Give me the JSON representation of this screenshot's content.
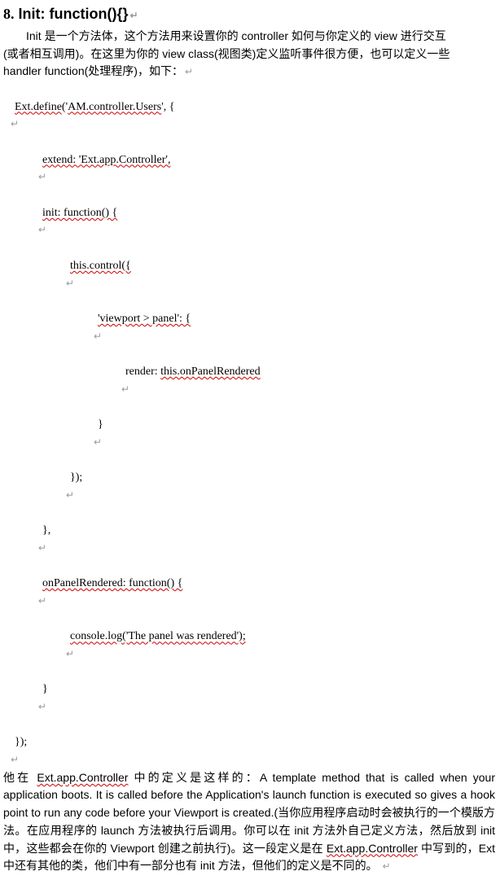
{
  "heading": {
    "number": "8.",
    "title": "Init: function(){}"
  },
  "intro": {
    "p1_a": "Init 是一个方法体，这个方法用来设置你的 controller 如何与你定义的 view 进行交互",
    "p1_b": "(或者相互调用)。在这里为你的 view class(视图类)定义监听事件很方便，也可以定义一些",
    "p1_c": "handler function(处理程序)，如下："
  },
  "code": {
    "l1_a": "Ext.define",
    "l1_b": "('",
    "l1_c": "AM.controller.Users",
    "l1_d": "', {",
    "l2": "extend: 'Ext.app.Controller',",
    "l3": "init: function() {",
    "l4": "this.control({",
    "l5": "'viewport > panel': {",
    "l6_a": "render: ",
    "l6_b": "this.onPanelRendered",
    "l7": "}",
    "l8": "});",
    "l9": "},",
    "l10": "onPanelRendered: function() {",
    "l11": "console.log('The panel was rendered');",
    "l12": "}",
    "l13": "});"
  },
  "outro": {
    "t1": "他在 ",
    "link1": "Ext.app.Controller",
    "t2": " 中的定义是这样的：A template method that is called when your application boots. It is called before the Application's launch function is executed so gives a hook point to run any code before your Viewport is created.(当你应用程序启动时会被执行的一个模版方法。在应用程序的 launch 方法被执行后调用。你可以在 init 方法外自己定义方法，然后放到 init 中，这些都会在你的 Viewport 创建之前执行)。这一段定义是在 ",
    "link2": "Ext.app.Controller",
    "t3": " 中写到的，Ext 中还有其他的类，他们中有一部分也有 init 方法，但他们的定义是不同的。"
  }
}
